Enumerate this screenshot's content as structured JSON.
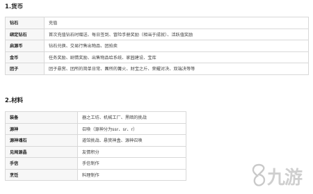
{
  "sections": [
    {
      "title": "1.货币",
      "rows": [
        {
          "key": "钻石",
          "value": "充值"
        },
        {
          "key": "绑定钻石",
          "value": "首次充值钻石时赠送、每日签到、冒险手册奖励（相当于成就）、活跃值奖励"
        },
        {
          "key": "启源币",
          "value": "钻石兑换、交易行售出物品、团拍卖"
        },
        {
          "key": "金币",
          "value": "任务奖励、剧情奖励、出售物品给系统、家园建设、宝库"
        },
        {
          "key": "团子",
          "value": "团子悬赏、团所的简单日常、團所的篝火、财宝之斤、荣耀对决、双端决等等"
        }
      ]
    },
    {
      "title": "2.材料",
      "rows": [
        {
          "key": "装备",
          "value": "器之工坊、机械工厂、黑暗的挑战"
        },
        {
          "key": "源神",
          "value": "召唤（源神分为ssr、sr、r）"
        },
        {
          "key": "源神魂石",
          "value": "道馆挑战、悬赏神盒、源神召唤"
        },
        {
          "key": "见闻源晶",
          "value": "友情积分"
        },
        {
          "key": "手信",
          "value": "手信制作"
        },
        {
          "key": "烹饪",
          "value": "料理制作"
        }
      ]
    }
  ],
  "watermark": {
    "text": "九游",
    "icon": "jiuyou-logo-icon"
  }
}
